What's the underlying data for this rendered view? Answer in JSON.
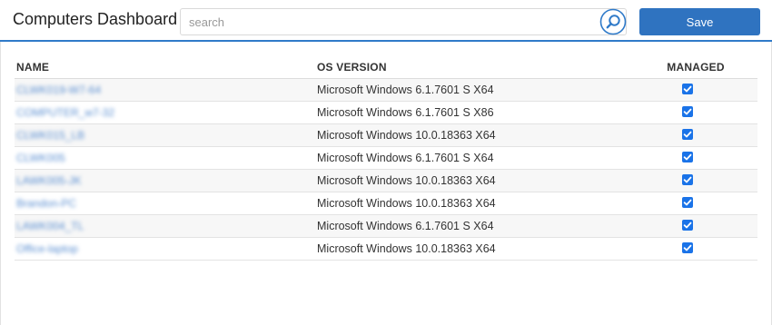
{
  "header": {
    "title": "Computers Dashboard",
    "search_placeholder": "search",
    "search_value": "",
    "save_label": "Save"
  },
  "colors": {
    "accent": "#2f7ac9",
    "save_button": "#2f73c0",
    "checkbox": "#1a73e8"
  },
  "table": {
    "columns": [
      "NAME",
      "OS VERSION",
      "MANAGED"
    ],
    "rows": [
      {
        "name": "CLWK019-W7-64",
        "os": "Microsoft Windows 6.1.7601 S X64",
        "managed": true
      },
      {
        "name": "COMPUTER_w7-32",
        "os": "Microsoft Windows 6.1.7601 S X86",
        "managed": true
      },
      {
        "name": "CLWK015_LB",
        "os": "Microsoft Windows 10.0.18363 X64",
        "managed": true
      },
      {
        "name": "CLWK005",
        "os": "Microsoft Windows 6.1.7601 S X64",
        "managed": true
      },
      {
        "name": "LAWK005-JK",
        "os": "Microsoft Windows 10.0.18363 X64",
        "managed": true
      },
      {
        "name": "Brandon-PC",
        "os": "Microsoft Windows 10.0.18363 X64",
        "managed": true
      },
      {
        "name": "LAWK004_TL",
        "os": "Microsoft Windows 6.1.7601 S X64",
        "managed": true
      },
      {
        "name": "Office-laptop",
        "os": "Microsoft Windows 10.0.18363 X64",
        "managed": true
      }
    ]
  }
}
